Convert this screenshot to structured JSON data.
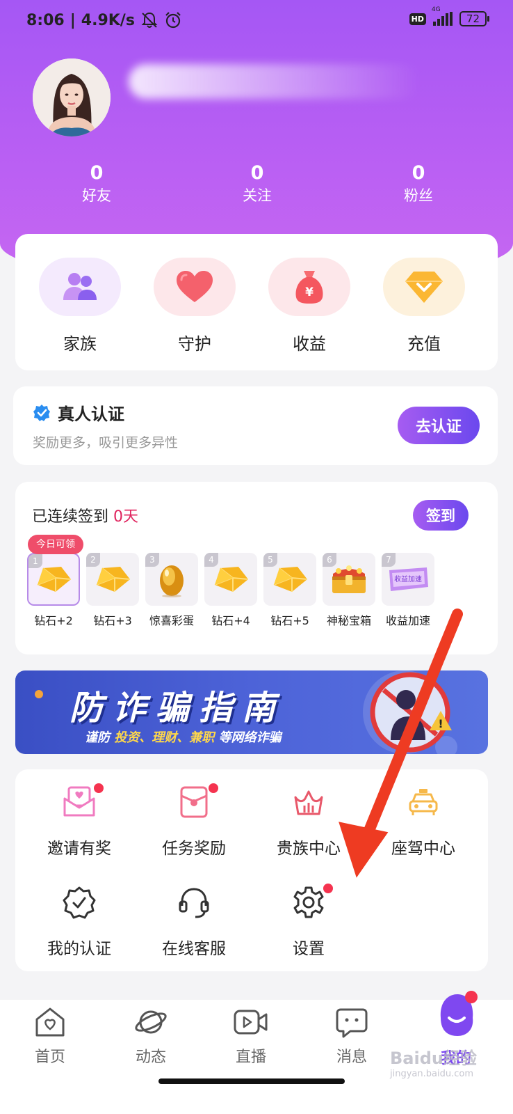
{
  "status_bar": {
    "time": "8:06",
    "network_speed": "4.9K/s",
    "network_type": "4G",
    "hd": "HD",
    "battery": "72"
  },
  "profile": {
    "stats": [
      {
        "count": "0",
        "label": "好友"
      },
      {
        "count": "0",
        "label": "关注"
      },
      {
        "count": "0",
        "label": "粉丝"
      }
    ]
  },
  "quick_actions": [
    {
      "label": "家族",
      "icon": "family-icon"
    },
    {
      "label": "守护",
      "icon": "heart-icon"
    },
    {
      "label": "收益",
      "icon": "money-bag-icon"
    },
    {
      "label": "充值",
      "icon": "diamond-icon"
    }
  ],
  "verification": {
    "title": "真人认证",
    "subtitle": "奖励更多，吸引更多异性",
    "button": "去认证"
  },
  "checkin": {
    "title_prefix": "已连续签到",
    "days": "0天",
    "button": "签到",
    "today_badge": "今日可领",
    "rewards": [
      {
        "no": "1",
        "label": "钻石+2",
        "icon": "diamond-gold-icon"
      },
      {
        "no": "2",
        "label": "钻石+3",
        "icon": "diamond-gold-icon"
      },
      {
        "no": "3",
        "label": "惊喜彩蛋",
        "icon": "golden-egg-icon"
      },
      {
        "no": "4",
        "label": "钻石+4",
        "icon": "diamond-gold-icon"
      },
      {
        "no": "5",
        "label": "钻石+5",
        "icon": "diamond-gold-icon"
      },
      {
        "no": "6",
        "label": "神秘宝箱",
        "icon": "treasure-chest-icon"
      },
      {
        "no": "7",
        "label": "收益加速",
        "icon": "speed-ticket-icon",
        "ticket_text": "收益加速"
      }
    ]
  },
  "banner": {
    "title": "防诈骗指南",
    "sub_prefix": "谨防",
    "sub_highlight": "投资、理财、兼职",
    "sub_suffix": "等网络诈骗"
  },
  "menu": [
    {
      "label": "邀请有奖",
      "icon": "invite-envelope-icon",
      "dot": true
    },
    {
      "label": "任务奖励",
      "icon": "task-reward-icon",
      "dot": true
    },
    {
      "label": "贵族中心",
      "icon": "crown-icon",
      "dot": false
    },
    {
      "label": "座驾中心",
      "icon": "car-icon",
      "dot": false
    },
    {
      "label": "我的认证",
      "icon": "verified-badge-icon",
      "dot": false
    },
    {
      "label": "在线客服",
      "icon": "headset-icon",
      "dot": false
    },
    {
      "label": "设置",
      "icon": "gear-icon",
      "dot": true
    }
  ],
  "tabs": [
    {
      "label": "首页",
      "icon": "home-icon"
    },
    {
      "label": "动态",
      "icon": "planet-icon"
    },
    {
      "label": "直播",
      "icon": "video-icon"
    },
    {
      "label": "消息",
      "icon": "chat-icon"
    },
    {
      "label": "我的",
      "icon": "profile-mascot-icon",
      "active": true
    }
  ],
  "watermark": {
    "text": "Baidu经验",
    "url": "jingyan.baidu.com"
  },
  "colors": {
    "header_purple": "#a557f4",
    "accent_purple": "#7a46f0",
    "dot_red": "#f5334f",
    "days_red": "#e0245e",
    "arrow_red": "#ee3b22"
  }
}
